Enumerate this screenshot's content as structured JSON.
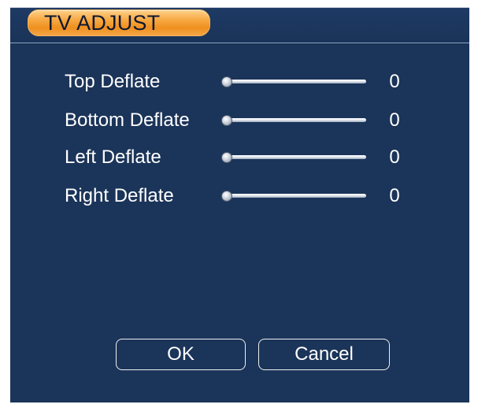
{
  "dialog": {
    "title": "TV ADJUST"
  },
  "settings": [
    {
      "label": "Top Deflate",
      "value": "0",
      "level": 0
    },
    {
      "label": "Bottom Deflate",
      "value": "0",
      "level": 0
    },
    {
      "label": "Left Deflate",
      "value": "0",
      "level": 0
    },
    {
      "label": "Right Deflate",
      "value": "0",
      "level": 0
    }
  ],
  "buttons": {
    "ok_label": "OK",
    "cancel_label": "Cancel"
  },
  "colors": {
    "background": "#1b3459",
    "title_tab": "#f7a942",
    "text": "#ffffff"
  }
}
